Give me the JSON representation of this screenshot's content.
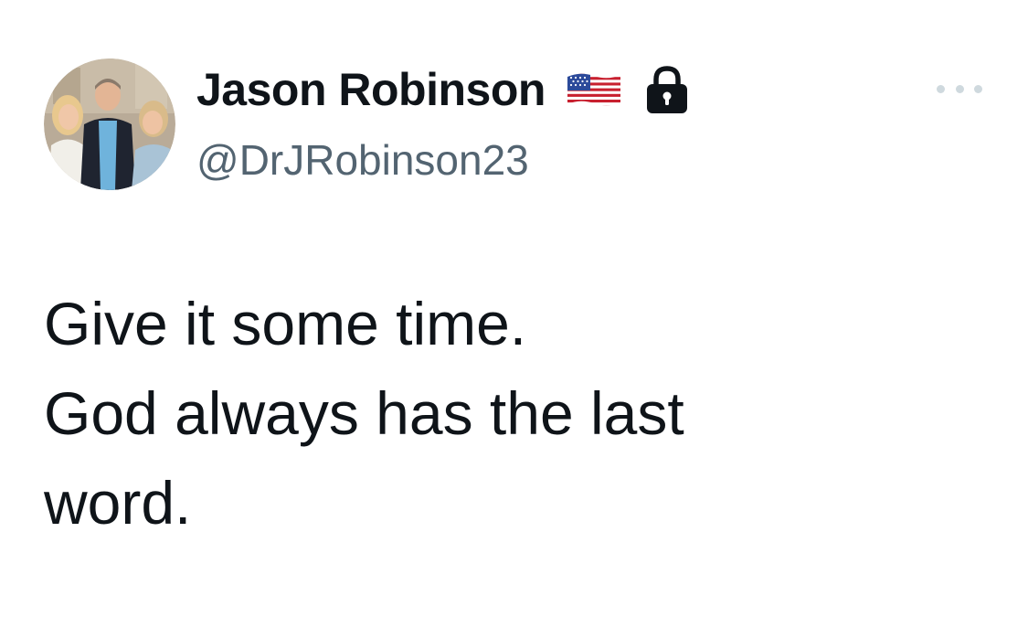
{
  "author": {
    "display_name": "Jason Robinson",
    "handle": "@DrJRobinson23",
    "badges": [
      "us-flag-icon",
      "lock-icon"
    ]
  },
  "tweet": {
    "lines": [
      "Give it some time.",
      "God always has the last",
      "word."
    ]
  },
  "menu": {
    "icon": "more-horizontal-icon"
  },
  "colors": {
    "text_primary": "#0f1419",
    "text_secondary": "#536471",
    "dots": "#cfd9de"
  }
}
